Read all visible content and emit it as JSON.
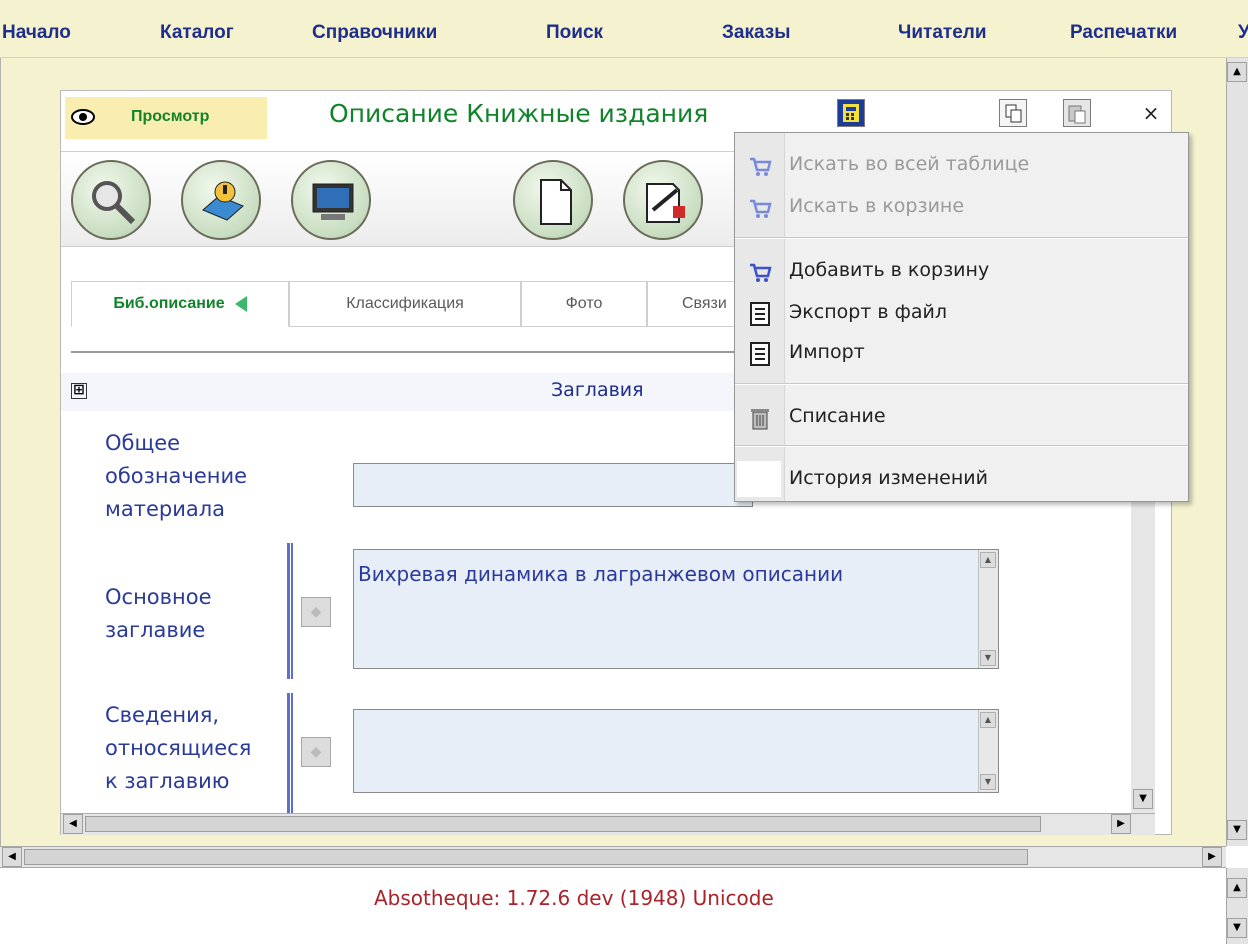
{
  "top_menu": [
    "Начало",
    "Каталог",
    "Справочники",
    "Поиск",
    "Заказы",
    "Читатели",
    "Распечатки",
    "У"
  ],
  "window": {
    "mode_label": "Просмотр",
    "title": "Описание Книжные издания",
    "close_glyph": "×"
  },
  "tabs": [
    {
      "label": "Биб.описание",
      "active": true
    },
    {
      "label": "Классификация",
      "active": false
    },
    {
      "label": "Фото",
      "active": false
    },
    {
      "label": "Связи",
      "active": false
    }
  ],
  "section": {
    "title": "Заглавия",
    "expand_glyph": "⊞"
  },
  "fields": [
    {
      "label_lines": [
        "Общее",
        "обозначение",
        "материала"
      ],
      "value": ""
    },
    {
      "label_lines": [
        "Основное",
        "заглавие"
      ],
      "value": "Вихревая динамика в лагранжевом описании"
    },
    {
      "label_lines": [
        "Сведения,",
        "относящиеся",
        "к заглавию"
      ],
      "value": ""
    }
  ],
  "context_menu": {
    "items": [
      {
        "label": "Искать во всей таблице",
        "icon": "cart-icon",
        "enabled": false
      },
      {
        "label": "Искать в корзине",
        "icon": "cart-icon",
        "enabled": false
      },
      {
        "label": "Добавить в корзину",
        "icon": "cart-icon",
        "enabled": true
      },
      {
        "label": "Экспорт в файл",
        "icon": "document-icon",
        "enabled": true
      },
      {
        "label": "Импорт",
        "icon": "document-icon",
        "enabled": true
      },
      {
        "label": "Списание",
        "icon": "trash-icon",
        "enabled": true
      },
      {
        "label": "История изменений",
        "icon": "",
        "enabled": true
      }
    ]
  },
  "status": {
    "text": "Absotheque: 1.72.6 dev (1948) Unicode"
  },
  "colors": {
    "menu_bg": "#f4f2cf",
    "menu_text": "#1f2e8a",
    "title_green": "#11842b",
    "label_blue": "#2a3a9a",
    "status_red": "#a8232a",
    "field_bg": "#e8eef8"
  }
}
